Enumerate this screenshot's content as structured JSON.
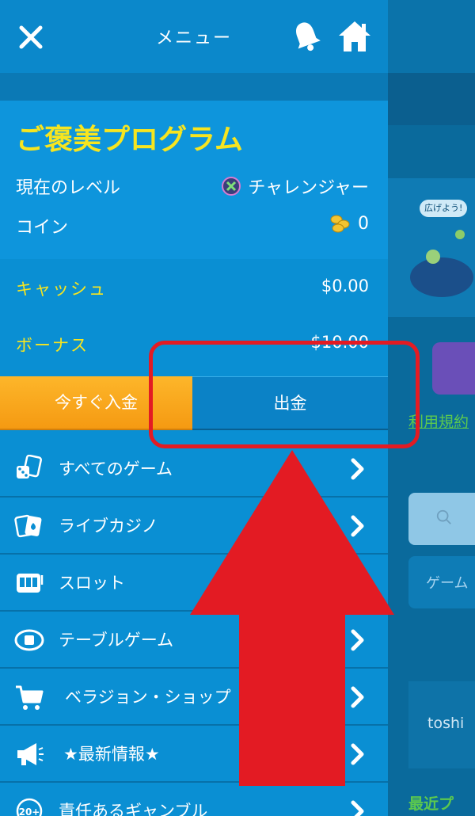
{
  "header": {
    "title": "メニュー"
  },
  "rewards": {
    "title": "ご褒美プログラム",
    "level_label": "現在のレベル",
    "level_value": "チャレンジャー",
    "coin_label": "コイン",
    "coin_value": "0"
  },
  "balances": {
    "cash_label": "キャッシュ",
    "cash_value": "$0.00",
    "bonus_label": "ボーナス",
    "bonus_value": "$10.00"
  },
  "actions": {
    "deposit_label": "今すぐ入金",
    "withdraw_label": "出金"
  },
  "nav": [
    {
      "label": "すべてのゲーム",
      "icon": "dice-cards-icon"
    },
    {
      "label": "ライブカジノ",
      "icon": "playing-cards-icon"
    },
    {
      "label": "スロット",
      "icon": "slot-machine-icon"
    },
    {
      "label": "テーブルゲーム",
      "icon": "table-game-icon"
    },
    {
      "label": "ベラジョン・ショップ",
      "icon": "shopping-cart-icon"
    },
    {
      "label": "★最新情報★",
      "icon": "megaphone-icon"
    },
    {
      "label": "責任あるギャンブル",
      "icon": "age-20-icon"
    }
  ],
  "background_page": {
    "banner_badge": "広げよう!",
    "terms_link": "利用規約",
    "game_label": "ゲーム",
    "user_name": "toshi",
    "recent_label": "最近プ"
  },
  "colors": {
    "drawer_bg": "#0a8fd3",
    "accent_yellow": "#f7e51f",
    "deposit_orange": "#f8a81c",
    "annotation_red": "#e31b23"
  }
}
